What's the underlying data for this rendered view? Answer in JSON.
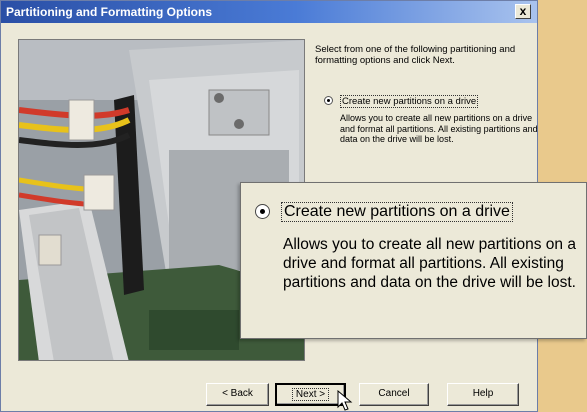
{
  "window": {
    "title": "Partitioning and Formatting Options",
    "close_label": "x"
  },
  "instructions": "Select from one of the following partitioning and formatting options and click Next.",
  "option": {
    "label": "Create new partitions on a drive",
    "description": "Allows you to create all new partitions on a drive and format all partitions.  All existing partitions and data on the drive will be lost.",
    "selected": true
  },
  "zoom_option": {
    "label": "Create new partitions on a drive",
    "description": "Allows you to create all new partitions on a drive and format all partitions.  All existing partitions and data on the drive will be lost."
  },
  "buttons": {
    "back": "< Back",
    "next": "Next >",
    "cancel": "Cancel",
    "help": "Help"
  },
  "colors": {
    "title_bar": "#2a4fa6",
    "window_bg": "#ece9d8",
    "page_bg": "#e9c98c"
  }
}
